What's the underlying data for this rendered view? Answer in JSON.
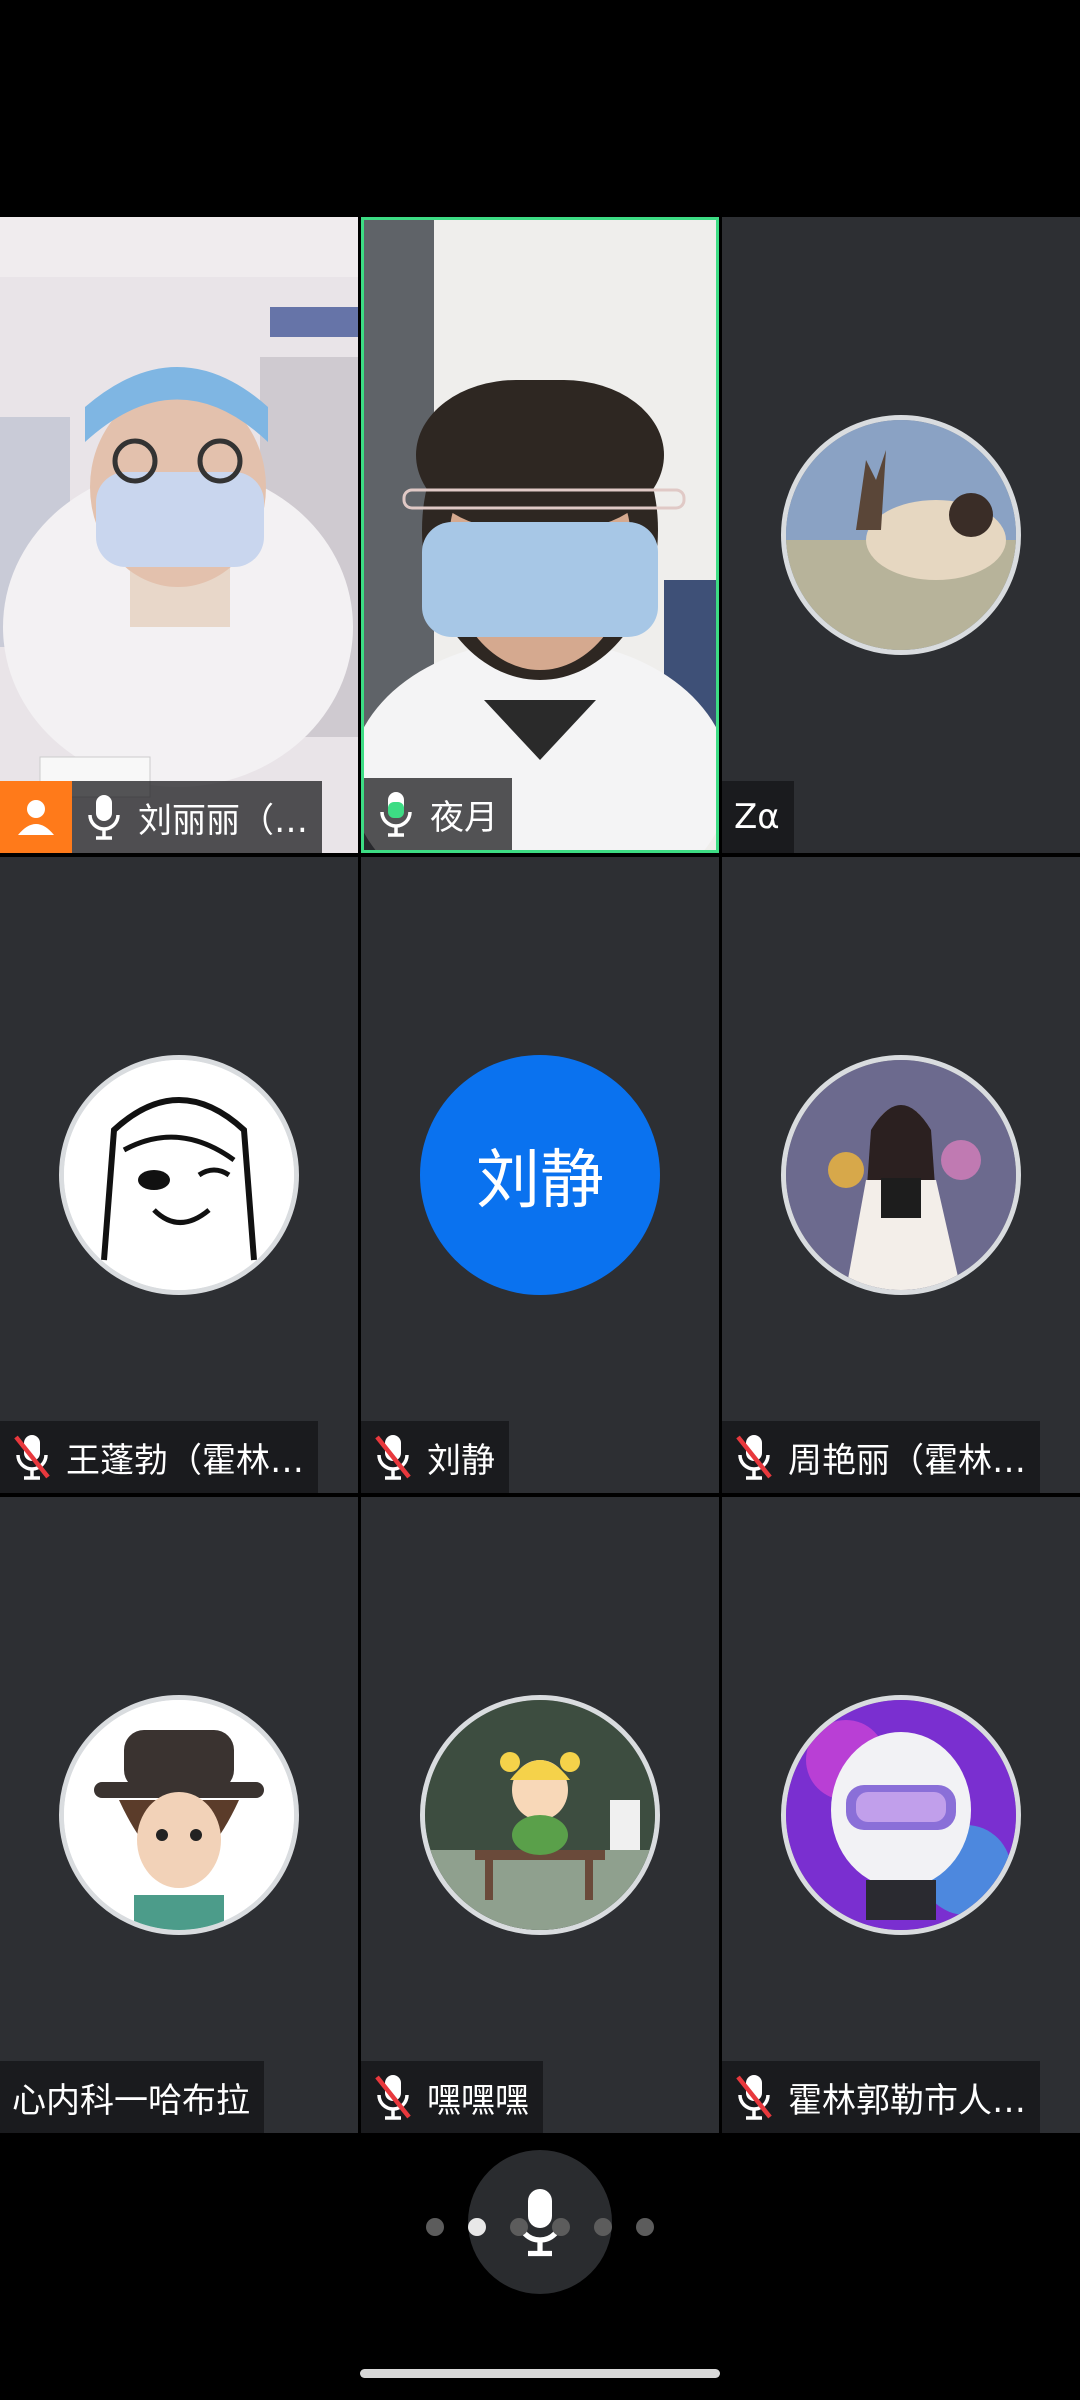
{
  "participants": [
    {
      "name": "刘丽丽（…",
      "mic": "active",
      "host": true,
      "type": "video",
      "photo": "doctor-cap"
    },
    {
      "name": "夜月",
      "mic": "speaking",
      "host": false,
      "type": "video",
      "photo": "doctor-glasses",
      "active_speaker": true
    },
    {
      "name": "Zα",
      "mic": "none",
      "host": false,
      "type": "avatar",
      "avatar_icon": "landscape-avatar-icon"
    },
    {
      "name": "王蓬勃（霍林…",
      "mic": "muted",
      "type": "avatar",
      "avatar_icon": "cartoon-girl-avatar-icon"
    },
    {
      "name": "刘静",
      "mic": "muted",
      "type": "text-avatar",
      "avatar_text": "刘静"
    },
    {
      "name": "周艳丽（霍林…",
      "mic": "muted",
      "type": "avatar",
      "avatar_icon": "woman-flowers-avatar-icon"
    },
    {
      "name": "心内科一哈布拉",
      "mic": "none",
      "type": "avatar",
      "avatar_icon": "cartoon-hat-girl-avatar-icon"
    },
    {
      "name": "嘿嘿嘿",
      "mic": "muted",
      "type": "avatar",
      "avatar_icon": "cartoon-watermelon-avatar-icon"
    },
    {
      "name": "霍林郭勒市人…",
      "mic": "muted",
      "type": "avatar",
      "avatar_icon": "helmet-neon-avatar-icon"
    }
  ],
  "colors": {
    "active_border": "#3ddc84",
    "host_badge": "#ff7a1a",
    "text_avatar": "#0a72ef",
    "muted_red": "#e8383d",
    "speaking_green": "#3ddc84"
  },
  "pager": {
    "total": 6,
    "current": 2
  },
  "controls": {
    "mic_icon": "microphone-icon"
  }
}
